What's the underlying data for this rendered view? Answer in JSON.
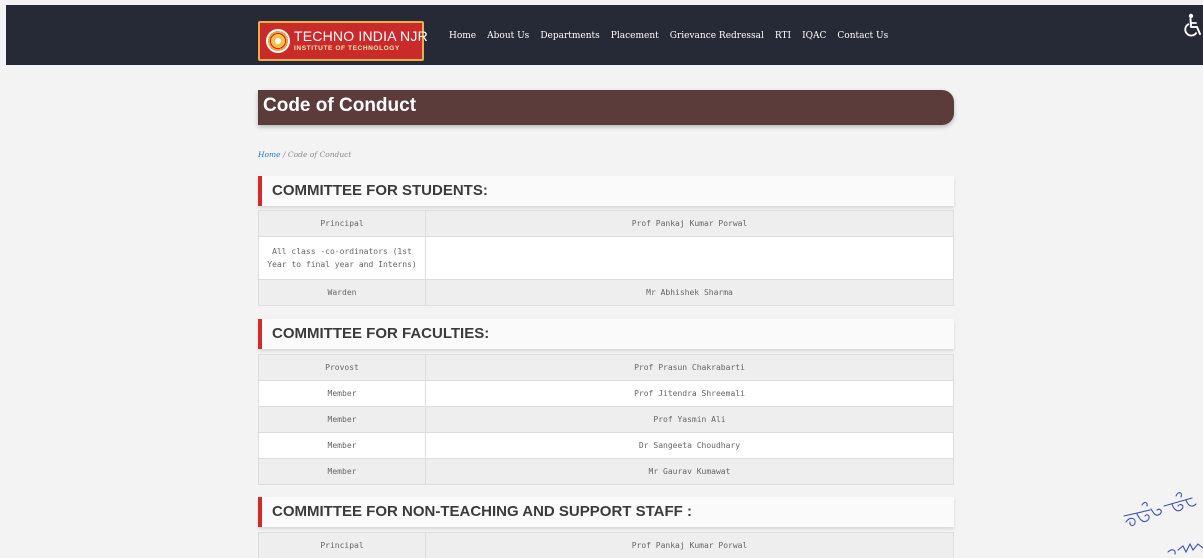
{
  "header": {
    "logo_title": "TECHNO INDIA NJR",
    "logo_subtitle": "INSTITUTE OF TECHNOLOGY",
    "nav": [
      "Home",
      "About Us",
      "Departments",
      "Placement",
      "Grievance Redressal",
      "RTI",
      "IQAC",
      "Contact Us"
    ]
  },
  "page": {
    "title": "Code of Conduct",
    "breadcrumb": {
      "home": "Home",
      "separator": " / ",
      "current": "Code of Conduct"
    }
  },
  "sections": [
    {
      "heading": "COMMITTEE FOR STUDENTS:",
      "rows": [
        {
          "role": "Principal",
          "name": "Prof Pankaj Kumar Porwal"
        },
        {
          "role": "All class -co-ordinators (1st Year to final year and Interns)",
          "name": ""
        },
        {
          "role": "Warden",
          "name": "Mr Abhishek Sharma"
        }
      ]
    },
    {
      "heading": "COMMITTEE FOR FACULTIES:",
      "rows": [
        {
          "role": "Provost",
          "name": "Prof Prasun Chakrabarti"
        },
        {
          "role": "Member",
          "name": "Prof Jitendra Shreemali"
        },
        {
          "role": "Member",
          "name": "Prof Yasmin Ali"
        },
        {
          "role": "Member",
          "name": "Dr Sangeeta Choudhary"
        },
        {
          "role": "Member",
          "name": "Mr Gaurav Kumawat"
        }
      ]
    },
    {
      "heading": "COMMITTEE FOR NON-TEACHING AND SUPPORT STAFF :",
      "rows": [
        {
          "role": "Principal",
          "name": "Prof Pankaj Kumar Porwal"
        }
      ]
    }
  ],
  "colors": {
    "topbar": "#262a36",
    "banner": "#5b3c3b",
    "accent": "#cf2b2b",
    "link": "#2a7bd1"
  },
  "icons": {
    "accessibility": "wheelchair-icon",
    "logo": "institute-emblem-icon"
  }
}
